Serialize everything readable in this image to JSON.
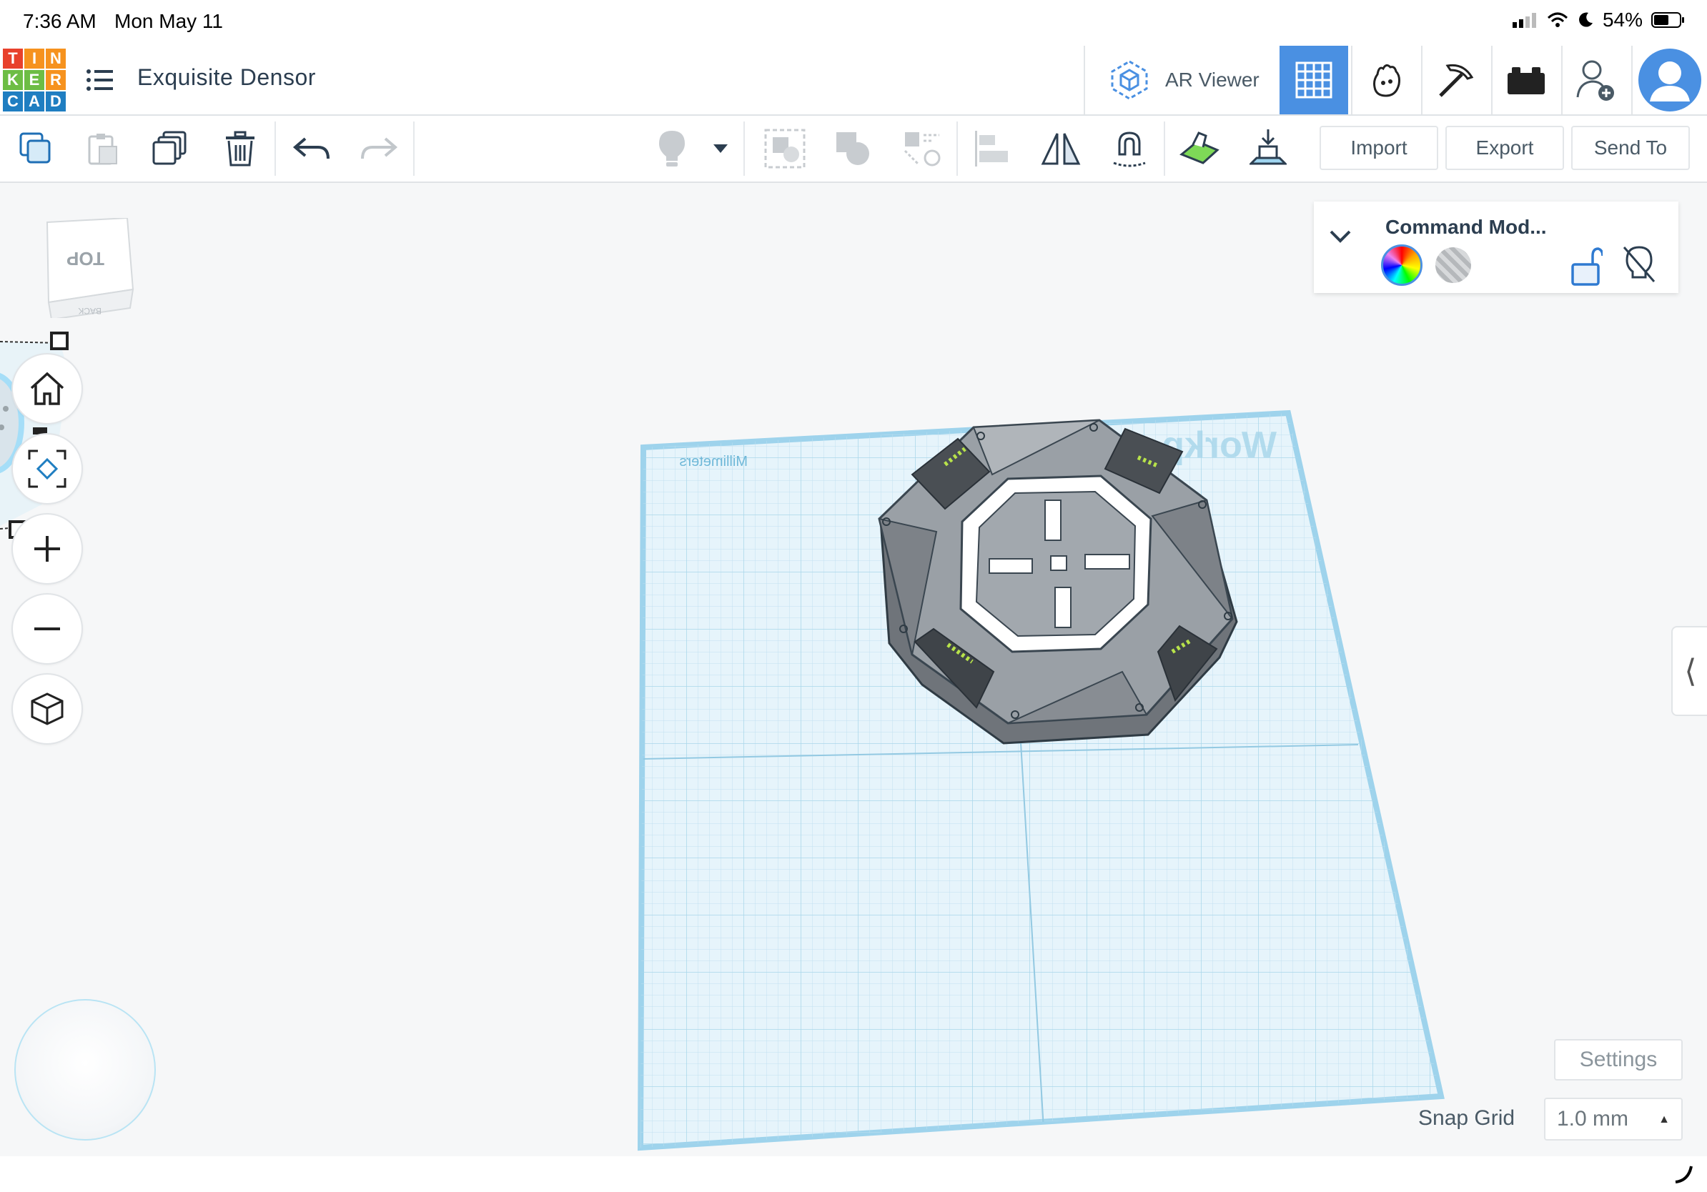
{
  "status_bar": {
    "time": "7:36 AM",
    "date": "Mon May 11",
    "battery": "54%"
  },
  "header": {
    "logo_letters": [
      "T",
      "I",
      "N",
      "K",
      "E",
      "R",
      "C",
      "A",
      "D"
    ],
    "design_title": "Exquisite Densor",
    "ar_viewer_label": "AR Viewer"
  },
  "toolbar": {
    "import_label": "Import",
    "export_label": "Export",
    "send_to_label": "Send To"
  },
  "viewcube": {
    "front_label": "TOP",
    "side_label": "BACK"
  },
  "workplane": {
    "units_label": "Millimeters",
    "plane_label": "Workp"
  },
  "inspector": {
    "title": "Command Mod..."
  },
  "bottom": {
    "settings_label": "Settings",
    "snap_grid_label": "Snap Grid",
    "snap_grid_value": "1.0 mm"
  },
  "colors": {
    "accent": "#4a90e2",
    "workplane_blue": "#c9e7f5",
    "model_gray": "#8c9196"
  }
}
